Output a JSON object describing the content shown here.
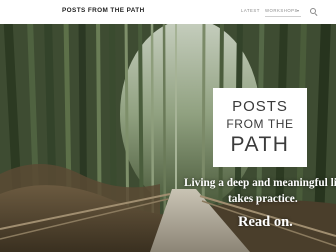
{
  "header": {
    "site_title": "POSTS FROM THE PATH",
    "nav": {
      "latest": "LATEST",
      "workshops": "WORKSHOPS"
    },
    "icons": [
      "chevron-down-icon",
      "search-icon"
    ]
  },
  "hero": {
    "title_line1": "POSTS",
    "title_line2": "FROM THE",
    "title_line3": "PATH",
    "tagline_line1": "Living a deep and meaningful life",
    "tagline_line2": "takes practice.",
    "cta": "Read on."
  },
  "colors": {
    "header_bg": "#ffffff",
    "title_text": "#1e1e1e",
    "nav_text": "#8a8a8a",
    "card_bg": "#ffffff",
    "card_text": "#3b3b3b",
    "hero_text": "#ffffff",
    "bamboo_green": "#4a5c3a"
  }
}
